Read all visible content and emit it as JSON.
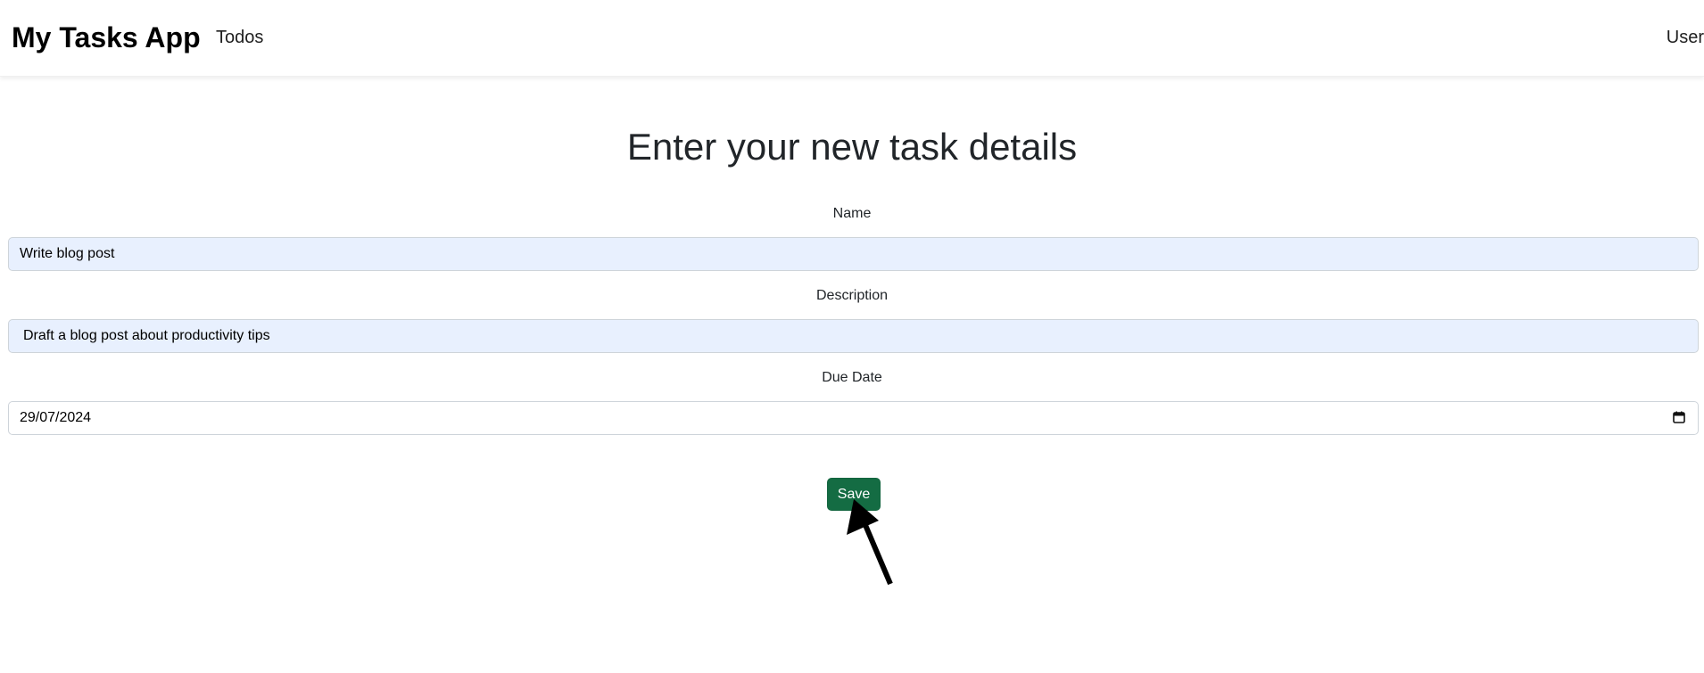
{
  "navbar": {
    "brand": "My Tasks App",
    "links": [
      {
        "label": "Todos"
      }
    ],
    "user_label": "User"
  },
  "form": {
    "title": "Enter your new task details",
    "fields": {
      "name": {
        "label": "Name",
        "value": "Write blog post"
      },
      "description": {
        "label": "Description",
        "value": "Draft a blog post about productivity tips"
      },
      "due_date": {
        "label": "Due Date",
        "value": "29/07/2024",
        "icon": "calendar-icon"
      }
    },
    "save_label": "Save"
  },
  "overlay": {
    "pointer_icon": "arrow-pointer-icon"
  },
  "colors": {
    "primary_button": "#146c43",
    "autofill_background": "#e8f0fe",
    "input_border": "#ced4da"
  }
}
